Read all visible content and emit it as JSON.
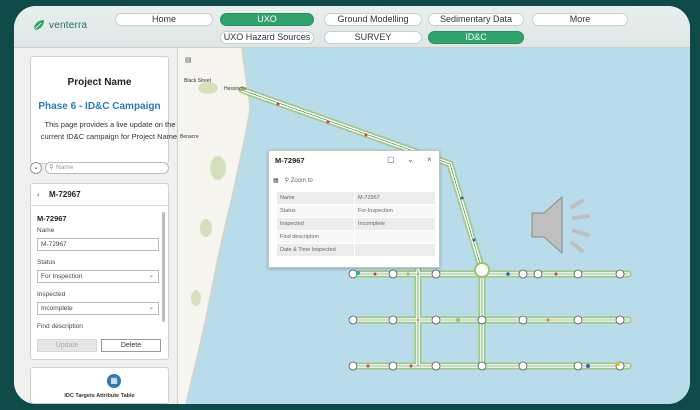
{
  "brand": {
    "name": "venterra",
    "accent": "#2ea36b"
  },
  "nav": {
    "row1": [
      "Home",
      "UXO",
      "Ground Modelling",
      "Sedimentary Data",
      "More"
    ],
    "row2": [
      "UXO Hazard Sources",
      "SURVEY",
      "ID&C"
    ],
    "active": [
      "UXO",
      "ID&C"
    ]
  },
  "project": {
    "title": "Project Name",
    "subtitle": "Phase 6 - ID&C Campaign",
    "description": "This page provides a live update on the current ID&C campaign for Project Name."
  },
  "search": {
    "placeholder": "Name"
  },
  "feature": {
    "header": "M-72967",
    "name_heading": "M-72967",
    "name_label": "Name",
    "name_value": "M-72967",
    "status_label": "Status",
    "status_value": "For Inspection",
    "inspected_label": "Inspected",
    "inspected_value": "Incomplete",
    "find_label": "Find description",
    "update_label": "Update",
    "delete_label": "Delete"
  },
  "attribute_table": {
    "label": "IDC Targets Attribute Table",
    "icon": "table-icon"
  },
  "map": {
    "place_labels": [
      "Black Street",
      "Hessingla",
      "Benacre"
    ],
    "sea_color": "#b8dcea",
    "land_color": "#f7f5ef"
  },
  "popup": {
    "title": "M-72967",
    "zoom_label": "Zoom to",
    "rows": [
      {
        "key": "Name",
        "value": "M-72967"
      },
      {
        "key": "Status",
        "value": "For Inspection"
      },
      {
        "key": "Inspected",
        "value": "Incomplete"
      },
      {
        "key": "Find description",
        "value": ""
      },
      {
        "key": "Date & Time Inspected",
        "value": ""
      }
    ]
  }
}
